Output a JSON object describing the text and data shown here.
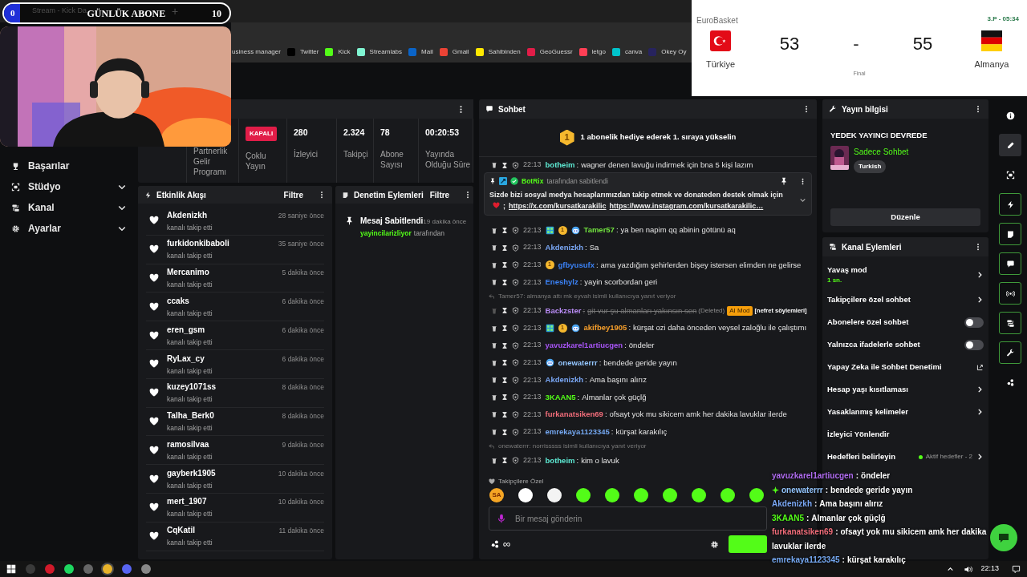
{
  "browser": {
    "tab_title": "Stream - Kick Da",
    "new_tab": "+",
    "bookmarks": [
      {
        "label": "usiness manager"
      },
      {
        "label": "Twitter",
        "color": "#000000"
      },
      {
        "label": "Kick",
        "color": "#53fc18"
      },
      {
        "label": "Streamlabs",
        "color": "#80f5d2"
      },
      {
        "label": "Mail",
        "color": "#0a64c8"
      },
      {
        "label": "Gmail",
        "color": "#ea4335"
      },
      {
        "label": "Sahibinden",
        "color": "#ffe800"
      },
      {
        "label": "GeoGuessr",
        "color": "#e11d48"
      },
      {
        "label": "letgo",
        "color": "#ff3f55"
      },
      {
        "label": "canva",
        "color": "#00c4cc"
      },
      {
        "label": "Okey Oy",
        "color": "#27235e"
      }
    ]
  },
  "sub_goal": {
    "current": "0",
    "title": "GÜNLÜK ABONE",
    "target": "10",
    "level": 0.07
  },
  "scoreboard": {
    "league": "EuroBasket",
    "clock": "3.P - 05:34",
    "home": {
      "name": "Türkiye",
      "score": "53",
      "kind": "tr"
    },
    "separator": "-",
    "away": {
      "name": "Almanya",
      "score": "55",
      "kind": "de"
    },
    "status": "Final"
  },
  "sidebar": {
    "items": [
      {
        "kind": "trophy",
        "label": "Başarılar"
      },
      {
        "kind": "studio",
        "label": "Stüdyo",
        "expanded": false
      },
      {
        "kind": "channel",
        "label": "Kanal",
        "expanded": false
      },
      {
        "kind": "settings",
        "label": "Ayarlar",
        "expanded": false
      }
    ]
  },
  "stats": [
    {
      "kind": "label",
      "label": "Partnerlik Gelir Programı"
    },
    {
      "kind": "badge",
      "value": "KAPALI",
      "label": "Çoklu Yayın"
    },
    {
      "kind": "number",
      "value": "280",
      "label": "İzleyici"
    },
    {
      "kind": "number",
      "value": "2.324",
      "label": "Takipçi"
    },
    {
      "kind": "number",
      "value": "78",
      "label": "Abone Sayısı"
    },
    {
      "kind": "number",
      "value": "00:20:53",
      "label": "Yayında Olduğu Süre"
    }
  ],
  "activity_feed": {
    "title": "Etkinlik Akışı",
    "filter": "Filtre",
    "events": [
      {
        "user": "Akdenizkh",
        "action": "kanalı takip etti",
        "time": "28 saniye önce"
      },
      {
        "user": "furkidonkibaboli",
        "action": "kanalı takip etti",
        "time": "35 saniye önce"
      },
      {
        "user": "Mercanimo",
        "action": "kanalı takip etti",
        "time": "5 dakika önce"
      },
      {
        "user": "ccaks",
        "action": "kanalı takip etti",
        "time": "6 dakika önce"
      },
      {
        "user": "eren_gsm",
        "action": "kanalı takip etti",
        "time": "6 dakika önce"
      },
      {
        "user": "RyLax_cy",
        "action": "kanalı takip etti",
        "time": "6 dakika önce"
      },
      {
        "user": "kuzey1071ss",
        "action": "kanalı takip etti",
        "time": "8 dakika önce"
      },
      {
        "user": "Talha_Berk0",
        "action": "kanalı takip etti",
        "time": "8 dakika önce"
      },
      {
        "user": "ramosilvaa",
        "action": "kanalı takip etti",
        "time": "9 dakika önce"
      },
      {
        "user": "gayberk1905",
        "action": "kanalı takip etti",
        "time": "10 dakika önce"
      },
      {
        "user": "mert_1907",
        "action": "kanalı takip etti",
        "time": "10 dakika önce"
      },
      {
        "user": "CqKatil",
        "action": "kanalı takip etti",
        "time": "11 dakika önce"
      }
    ]
  },
  "moderation": {
    "title": "Denetim Eylemleri",
    "filter": "Filtre",
    "entries": [
      {
        "title": "Mesaj Sabitlendi",
        "time": "19 dakika önce",
        "actor": "yayincilarizliyor",
        "suffix": "tarafından"
      }
    ]
  },
  "chat": {
    "title": "Sohbet",
    "promo_rank": "1",
    "promo": "1 abonelik hediye ederek 1. sıraya yükselin",
    "separator": ":",
    "pinned": {
      "by": "BotRix",
      "by_suffix": "tarafından sabitlendi",
      "text": "Sizde bizi sosyal medya hesaplarımızdan takip etmek ve donateden destek olmak için",
      "after_heart": ";",
      "links": [
        "https://x.com/kursatkarakilic",
        "https://www.instagram.com/kursatkarakilic…"
      ]
    },
    "messages": [
      {
        "kind": "message",
        "time": "22:13",
        "user": "botheim",
        "color": "#5eead4",
        "text": "wagner denen lavuğu indirmek için bna 5 kişi lazım",
        "deleted": false
      },
      {
        "kind": "message",
        "time": "22:13",
        "user": "Tamer57",
        "color": "#72e33f",
        "badges": [
          {
            "kind": "og"
          },
          {
            "kind": "gifter",
            "label": "1"
          },
          {
            "kind": "emote"
          }
        ],
        "text": "ya ben napim qq abinin götünü aq",
        "deleted": false
      },
      {
        "kind": "message",
        "time": "22:13",
        "user": "Akdenizkh",
        "color": "#7aa7f5",
        "text": "Sa",
        "deleted": false
      },
      {
        "kind": "message",
        "time": "22:13",
        "user": "gfbyusufx",
        "color": "#3b82f6",
        "badges": [
          {
            "kind": "gifter",
            "label": "1"
          }
        ],
        "text": "ama yazdığım şehirlerden bişey istersen elimden ne gelirse",
        "deleted": false
      },
      {
        "kind": "message",
        "time": "22:13",
        "user": "Eneshylz",
        "color": "#3b82f6",
        "text": "yayin scorbordan geri",
        "deleted": false
      },
      {
        "kind": "reply",
        "text": "Tamer57: almanya attı mk eyvah isimli kullanıcıya yanıt veriyor"
      },
      {
        "kind": "message",
        "time": "22:13",
        "user": "Backzster",
        "color": "#b98cf5",
        "text": "git vur şu almanları yakınsın sen",
        "deleted": true,
        "deleted_label": "(Deleted)",
        "mod_badge": "AI Mod",
        "reason": "[nefret söylemleri]"
      },
      {
        "kind": "message",
        "time": "22:13",
        "user": "akifbey1905",
        "color": "#f59e2b",
        "badges": [
          {
            "kind": "og"
          },
          {
            "kind": "gifter",
            "label": "1"
          },
          {
            "kind": "emote"
          }
        ],
        "text": "kürşat ozi daha önceden veysel zaloğlu ile çalıştımı",
        "deleted": false
      },
      {
        "kind": "message",
        "time": "22:13",
        "user": "yavuzkarel1artiucgen",
        "color": "#a855f7",
        "text": "öndeler",
        "deleted": false
      },
      {
        "kind": "message",
        "time": "22:13",
        "user": "onewaterrr",
        "color": "#93c5fd",
        "badges": [
          {
            "kind": "emote"
          }
        ],
        "text": "bendede geride yayın",
        "deleted": false
      },
      {
        "kind": "message",
        "time": "22:13",
        "user": "Akdenizkh",
        "color": "#7aa7f5",
        "text": "Ama başını alırız",
        "deleted": false
      },
      {
        "kind": "message",
        "time": "22:13",
        "user": "3KAAN5",
        "color": "#53fc18",
        "text": "Almanlar çok güçlğ",
        "deleted": false
      },
      {
        "kind": "message",
        "time": "22:13",
        "user": "furkanatsiken69",
        "color": "#f16d7a",
        "text": "ofsayt yok mu sikicem amk her dakika lavuklar ilerde",
        "deleted": false
      },
      {
        "kind": "message",
        "time": "22:13",
        "user": "emrekaya1123345",
        "color": "#74a7f0",
        "text": "kürşat karakılıç",
        "deleted": false
      },
      {
        "kind": "reply",
        "text": "onewaterrr: norrisssss isimli kullanıcıya yanıt veriyor"
      },
      {
        "kind": "message",
        "time": "22:13",
        "user": "botheim",
        "color": "#5eead4",
        "text": "kim o lavuk",
        "deleted": false
      }
    ],
    "emote_label": "Takipçilere Özel",
    "emotes": [
      {
        "color": "#f5a524",
        "label": "SA"
      },
      {
        "color": "#ffffff"
      },
      {
        "color": "#f3f3f3"
      },
      {
        "color": "#53fc18"
      },
      {
        "color": "#53fc18"
      },
      {
        "color": "#53fc18"
      },
      {
        "color": "#53fc18"
      },
      {
        "color": "#53fc18"
      },
      {
        "color": "#53fc18"
      },
      {
        "color": "#53fc18"
      }
    ],
    "placeholder": "Bir mesaj gönderin",
    "infinity": "∞"
  },
  "chat_overlay": {
    "separator": ":",
    "lines": [
      {
        "user": "yavuzkarel1artiucgen",
        "color": "#b06cf0",
        "text": "öndeler",
        "badge": false
      },
      {
        "user": "onewaterrr",
        "color": "#93c5fd",
        "text": "bendede geride yayın",
        "badge": true
      },
      {
        "user": "Akdenizkh",
        "color": "#7aa7f5",
        "text": "Ama başını alırız",
        "badge": false
      },
      {
        "user": "3KAAN5",
        "color": "#53fc18",
        "text": "Almanlar çok güçlğ",
        "badge": false
      },
      {
        "user": "furkanatsiken69",
        "color": "#f16d7a",
        "text": "ofsayt yok mu sikicem amk her dakika lavuklar ilerde",
        "badge": false
      },
      {
        "user": "emrekaya1123345",
        "color": "#74a7f0",
        "text": "kürşat karakılıç",
        "badge": false
      }
    ]
  },
  "stream_info": {
    "title": "Yayın bilgisi",
    "status": "YEDEK YAYINCI DEVREDE",
    "category": "Sadece Sohbet",
    "tag": "Turkish",
    "edit": "Düzenle"
  },
  "channel_actions": {
    "title": "Kanal Eylemleri",
    "items": [
      {
        "kind": "link",
        "label": "Yavaş mod",
        "value": "1 sn."
      },
      {
        "kind": "link",
        "label": "Takipçilere özel sohbet"
      },
      {
        "kind": "toggle",
        "label": "Abonelere özel sohbet",
        "on": false
      },
      {
        "kind": "toggle",
        "label": "Yalnızca ifadelerle sohbet",
        "on": false
      },
      {
        "kind": "external",
        "label": "Yapay Zeka ile Sohbet Denetimi"
      },
      {
        "kind": "link",
        "label": "Hesap yaşı kısıtlaması"
      },
      {
        "kind": "link",
        "label": "Yasaklanmış kelimeler"
      },
      {
        "kind": "plain",
        "label": "İzleyici Yönlendir"
      },
      {
        "kind": "goal",
        "label": "Hedefleri belirleyin",
        "value": "Aktif hedefler - 2"
      }
    ]
  },
  "rail": [
    {
      "kind": "info",
      "selected": false,
      "highlighted": false
    },
    {
      "kind": "pencil",
      "selected": true,
      "highlighted": false
    },
    {
      "kind": "camera",
      "selected": false,
      "highlighted": false
    },
    {
      "kind": "bolt",
      "selected": false,
      "highlighted": true
    },
    {
      "kind": "note",
      "selected": false,
      "highlighted": true
    },
    {
      "kind": "chat",
      "selected": false,
      "highlighted": true
    },
    {
      "kind": "broadcast",
      "selected": false,
      "highlighted": true
    },
    {
      "kind": "actions",
      "selected": false,
      "highlighted": true
    },
    {
      "kind": "wrench",
      "selected": false,
      "highlighted": true
    },
    {
      "kind": "dots",
      "selected": false,
      "highlighted": false
    }
  ],
  "taskbar": {
    "time": "22:13"
  }
}
